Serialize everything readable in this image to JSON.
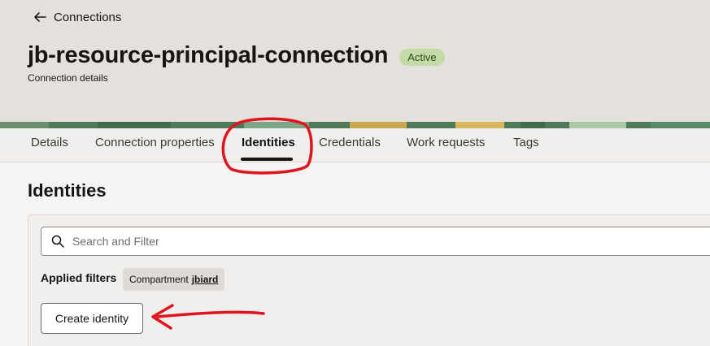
{
  "header": {
    "back_label": "Connections",
    "title": "jb-resource-principal-connection",
    "status": "Active",
    "subtitle": "Connection details"
  },
  "tabs": [
    {
      "label": "Details"
    },
    {
      "label": "Connection properties"
    },
    {
      "label": "Identities",
      "active": true
    },
    {
      "label": "Credentials"
    },
    {
      "label": "Work requests"
    },
    {
      "label": "Tags"
    }
  ],
  "section": {
    "title": "Identities"
  },
  "search": {
    "placeholder": "Search and Filter",
    "value": ""
  },
  "filters": {
    "label": "Applied filters",
    "chip_key": "Compartment",
    "chip_value": "jbiard"
  },
  "actions": {
    "create_label": "Create identity"
  },
  "colors": {
    "badge_bg": "#c4dba7",
    "annotation_red": "#e0141e"
  }
}
